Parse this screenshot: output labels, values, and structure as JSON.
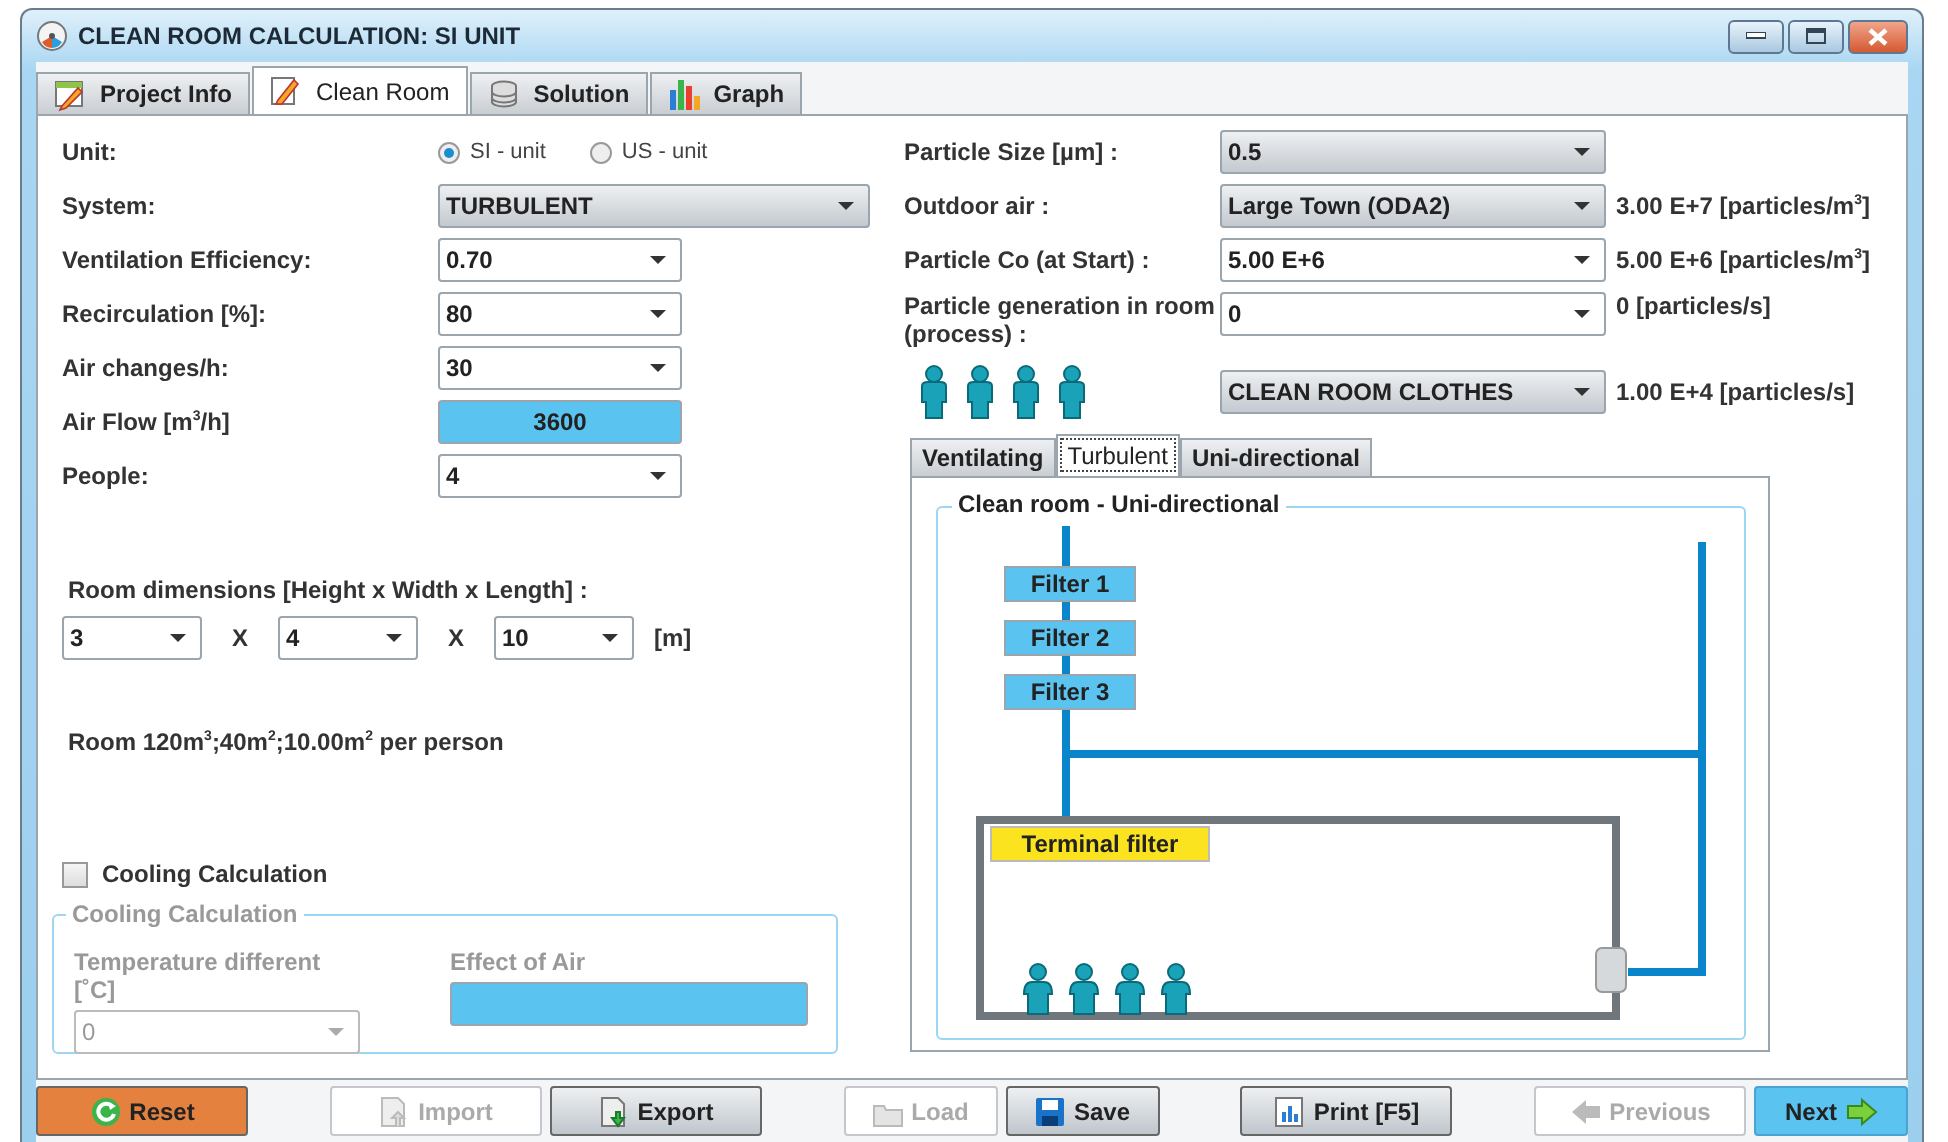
{
  "window": {
    "title": "CLEAN ROOM CALCULATION: SI UNIT"
  },
  "tabs": [
    {
      "label": "Project Info",
      "selected": false
    },
    {
      "label": "Clean Room",
      "selected": true
    },
    {
      "label": "Solution",
      "selected": false
    },
    {
      "label": "Graph",
      "selected": false
    }
  ],
  "unit": {
    "label": "Unit:",
    "options": [
      {
        "label": "SI - unit",
        "selected": true
      },
      {
        "label": "US - unit",
        "selected": false
      }
    ]
  },
  "left_fields": [
    {
      "label": "System:",
      "value": "TURBULENT",
      "kind": "wide-select"
    },
    {
      "label": "Ventilation Efficiency:",
      "value": "0.70",
      "kind": "dropdown"
    },
    {
      "label": "Recirculation [%]:",
      "value": "80",
      "kind": "dropdown"
    },
    {
      "label": "Air changes/h:",
      "value": "30",
      "kind": "dropdown"
    },
    {
      "label": "Air Flow [m$^{3}$/h]",
      "value": "3600",
      "kind": "display"
    },
    {
      "label": "People:",
      "value": "4",
      "kind": "dropdown"
    }
  ],
  "room_dimensions": {
    "label": "Room dimensions [Height x Width x Length] :",
    "values": [
      "3",
      "4",
      "10"
    ],
    "separators": [
      "X",
      "X"
    ],
    "unit": "[m]"
  },
  "room_summary": "Room 120m$^{3}$;40m$^{2}$;10.00m$^{2}$ per person",
  "cooling_checkbox": {
    "label": "Cooling Calculation",
    "checked": false
  },
  "cooling_group": {
    "title": "Cooling Calculation",
    "disabled": true,
    "temperature": {
      "label": "Temperature different [˚C]",
      "value": "0"
    },
    "effect": {
      "label": "Effect of Air"
    }
  },
  "right_fields": [
    {
      "label": "Particle Size [µm] :",
      "value": "0.5",
      "kind": "select"
    },
    {
      "label": "Outdoor air :",
      "value": "Large Town (ODA2)",
      "kind": "select",
      "reading": "3.00 E+7 [particles/m$^{3}$]"
    },
    {
      "label": "Particle Co (at Start) :",
      "value": "5.00 E+6",
      "kind": "dropdown",
      "reading": "5.00 E+6 [particles/m$^{3}$]"
    },
    {
      "label": "Particle generation in room (process) :",
      "value": "0",
      "kind": "dropdown",
      "reading": "0 [particles/s]"
    },
    {
      "kind": "clothes",
      "value": "CLEAN ROOM CLOTHES",
      "reading": "1.00 E+4 [particles/s]"
    }
  ],
  "sub_tabs": [
    {
      "label": "Ventilating",
      "selected": false
    },
    {
      "label": "Turbulent",
      "selected": true
    },
    {
      "label": "Uni-directional",
      "selected": false
    }
  ],
  "diagram": {
    "title": "Clean room - Uni-directional",
    "filters": [
      "Filter 1",
      "Filter 2",
      "Filter 3"
    ],
    "terminal_filter": "Terminal filter"
  },
  "button_groups": [
    [
      {
        "label": "Reset",
        "kind": "reset",
        "disabled": false
      }
    ],
    [
      {
        "label": "Import",
        "kind": "normal",
        "disabled": true
      },
      {
        "label": "Export",
        "kind": "normal",
        "disabled": false
      }
    ],
    [
      {
        "label": "Load",
        "kind": "normal",
        "disabled": true
      },
      {
        "label": "Save",
        "kind": "normal",
        "disabled": false
      }
    ],
    [
      {
        "label": "Print [F5]",
        "kind": "normal",
        "disabled": false
      }
    ],
    [
      {
        "label": "Previous",
        "kind": "normal",
        "disabled": true
      },
      {
        "label": "Next",
        "kind": "next",
        "disabled": false
      }
    ]
  ]
}
